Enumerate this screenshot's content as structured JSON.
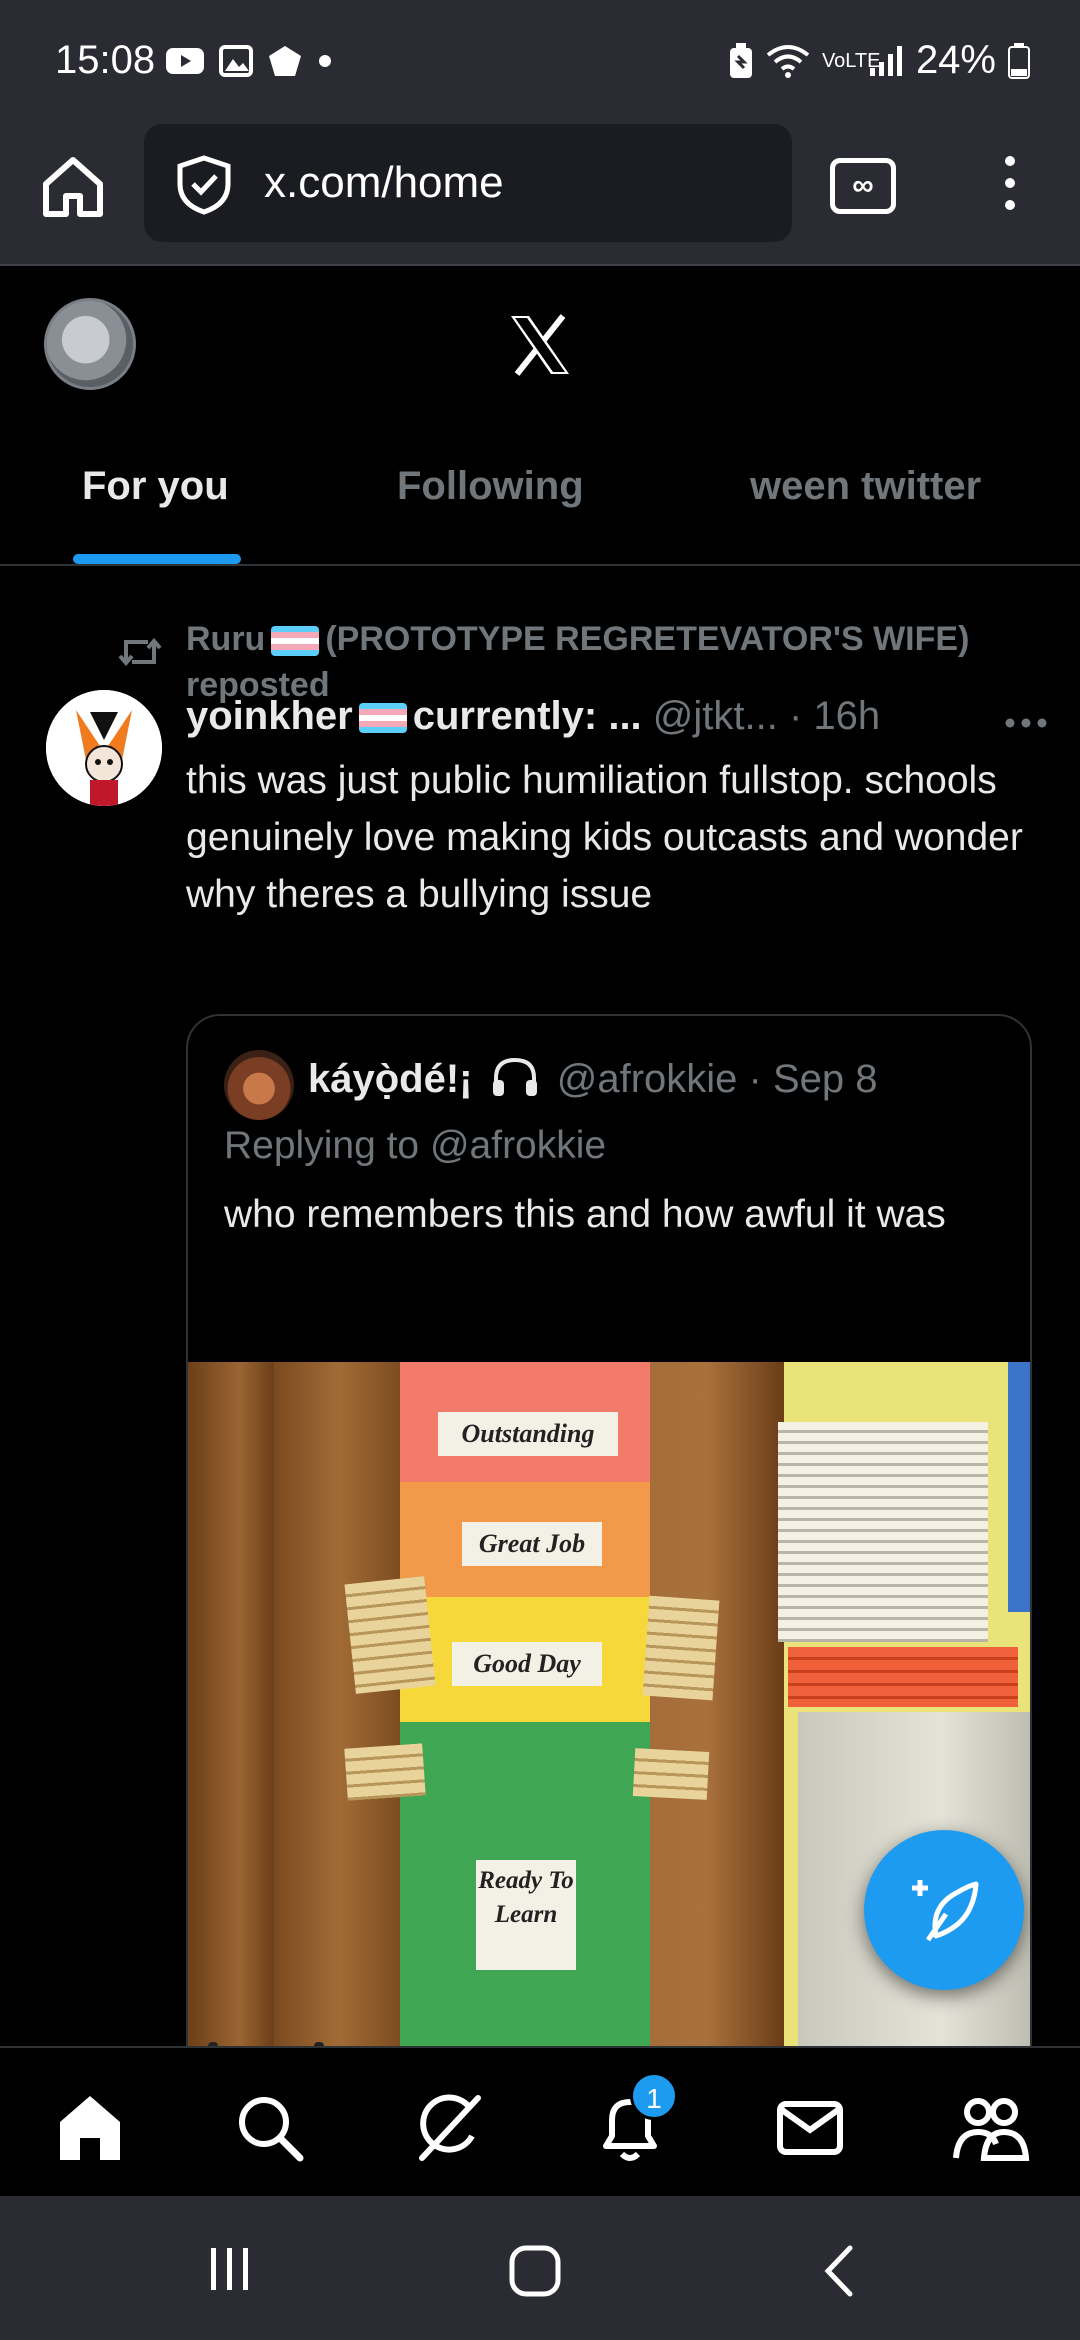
{
  "status_bar": {
    "time": "15:08",
    "network": "VoLTE",
    "battery": "24%"
  },
  "browser": {
    "url": "x.com/home",
    "tabs_icon_label": "∞"
  },
  "header": {
    "logo": "X",
    "tabs": [
      {
        "label": "For you",
        "active": true
      },
      {
        "label": "Following",
        "active": false
      },
      {
        "label": "ween twitter",
        "active": false
      }
    ]
  },
  "tweet": {
    "repost_prefix": "Ruru",
    "repost_suffix": "(PROTOTYPE REGRETEVATOR'S WIFE) reposted",
    "author_name": "yoinkher",
    "author_name_suffix": "currently: ...",
    "author_handle": "@jtkt...",
    "time": "· 16h",
    "text": "this was just public humiliation fullstop. schools genuinely love making kids outcasts and wonder why theres a bullying issue",
    "quote": {
      "author_name": "káyọ̀dé!¡",
      "author_handle": "@afrokkie",
      "time": "· Sep 8",
      "replying_to": "Replying to @afrokkie",
      "text": "who remembers this and how awful it was",
      "image_labels": {
        "outstanding": "Outstanding",
        "great_job": "Great Job",
        "good_day": "Good Day",
        "ready_to_learn": "Ready To Learn"
      }
    }
  },
  "bottom_nav": {
    "notifications_badge": "1"
  },
  "colors": {
    "accent": "#1d9bf0",
    "background": "#000000",
    "muted_text": "#71767b",
    "chrome": "#2b2c33"
  }
}
